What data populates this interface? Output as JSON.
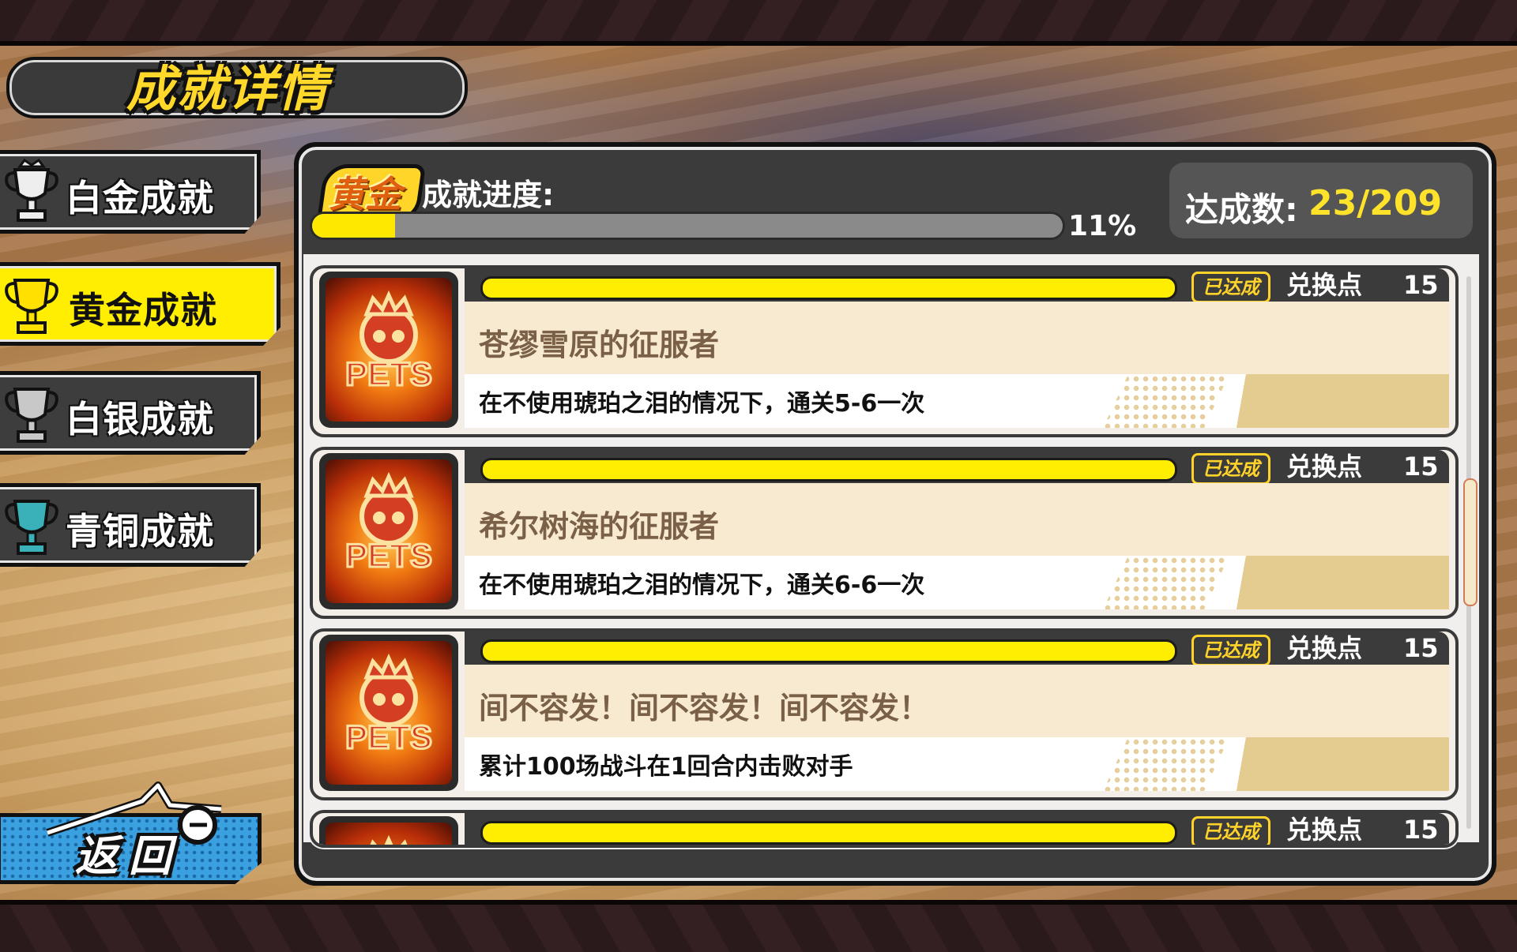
{
  "header": {
    "title": "成就详情"
  },
  "sidebar": {
    "tabs": [
      {
        "label": "白金成就",
        "trophy_color": "#e8e8e8",
        "active": false
      },
      {
        "label": "黄金成就",
        "trophy_color": "#ffe000",
        "active": true
      },
      {
        "label": "白银成就",
        "trophy_color": "#c8c8c8",
        "active": false
      },
      {
        "label": "青铜成就",
        "trophy_color": "#3ab0b8",
        "active": false
      }
    ],
    "back_label": "返回"
  },
  "panel": {
    "rank_badge": "黄金",
    "progress_label": "成就进度:",
    "progress_percent": 11,
    "progress_text": "11%",
    "count_label": "达成数:",
    "count_value": "23/209"
  },
  "achievements": [
    {
      "icon": "pets-icon",
      "icon_text": "PETS",
      "status": "已达成",
      "points_label": "兑换点",
      "points": "15",
      "name": "苍缪雪原的征服者",
      "desc": "在不使用琥珀之泪的情况下，通关5-6一次"
    },
    {
      "icon": "pets-icon",
      "icon_text": "PETS",
      "status": "已达成",
      "points_label": "兑换点",
      "points": "15",
      "name": "希尔树海的征服者",
      "desc": "在不使用琥珀之泪的情况下，通关6-6一次"
    },
    {
      "icon": "pets-icon",
      "icon_text": "PETS",
      "status": "已达成",
      "points_label": "兑换点",
      "points": "15",
      "name": "间不容发！间不容发！间不容发！",
      "desc": "累计100场战斗在1回合内击败对手"
    },
    {
      "icon": "pets-icon",
      "icon_text": "PETS",
      "status": "已达成",
      "points_label": "兑换点",
      "points": "15",
      "name": "",
      "desc": ""
    }
  ],
  "colors": {
    "accent": "#ffee00",
    "panel": "#3b3b3b",
    "name_text": "#7b6048"
  }
}
